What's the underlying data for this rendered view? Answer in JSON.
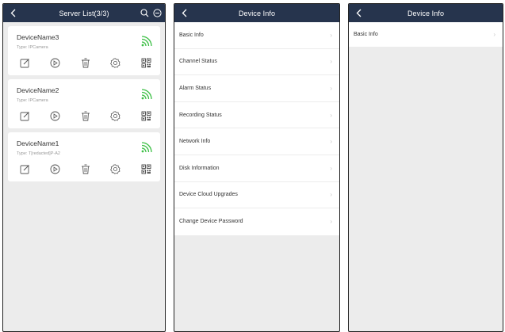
{
  "screen1": {
    "title": "Server List(3/3)",
    "devices": [
      {
        "name": "DeviceName3",
        "type": "Type: IPCamera"
      },
      {
        "name": "DeviceName2",
        "type": "Type: IPCamera"
      },
      {
        "name": "DeviceName1",
        "type": "Type: T[redacted]P-A2"
      }
    ],
    "action_icons": [
      "edit-icon",
      "play-icon",
      "trash-icon",
      "settings-icon",
      "qr-code-icon"
    ]
  },
  "screen2": {
    "title": "Device Info",
    "items": [
      "Basic Info",
      "Channel Status",
      "Alarm Status",
      "Recording Status",
      "Network Info",
      "Disk Information",
      "Device Cloud Upgrades",
      "Change Device Password"
    ]
  },
  "screen3": {
    "title": "Device Info",
    "items": [
      "Basic Info"
    ]
  },
  "colors": {
    "header_bg": "#26344d",
    "wifi_green": "#3cbf45",
    "page_bg": "#ececec"
  }
}
